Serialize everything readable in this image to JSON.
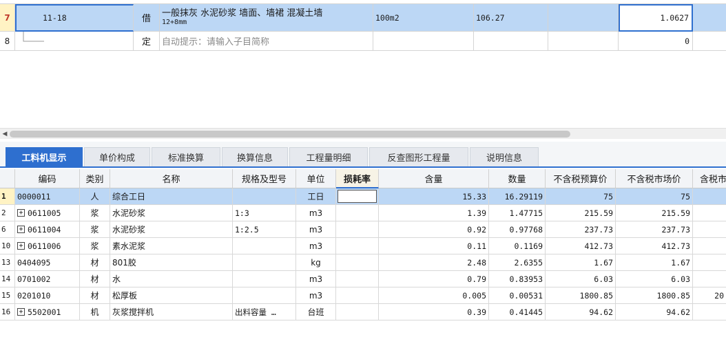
{
  "top_rows": [
    {
      "row_no": "7",
      "code": "11-18",
      "type": "借",
      "name_line1": "一般抹灰 水泥砂浆 墙面、墙裙 混凝土墙",
      "name_line2": "12+8mm",
      "unit": "100m2",
      "quantity": "106.27",
      "extra": "",
      "value": "1.0627"
    },
    {
      "row_no": "8",
      "code": "",
      "type": "定",
      "name_line1": "自动提示：请输入子目简称",
      "name_line2": "",
      "unit": "",
      "quantity": "",
      "extra": "",
      "value": "0"
    }
  ],
  "tabs": [
    {
      "label": "工料机显示",
      "active": true
    },
    {
      "label": "单价构成",
      "active": false
    },
    {
      "label": "标准换算",
      "active": false
    },
    {
      "label": "换算信息",
      "active": false
    },
    {
      "label": "工程量明细",
      "active": false
    },
    {
      "label": "反查图形工程量",
      "active": false
    },
    {
      "label": "说明信息",
      "active": false
    }
  ],
  "columns": [
    "编码",
    "类别",
    "名称",
    "规格及型号",
    "单位",
    "损耗率",
    "含量",
    "数量",
    "不含税预算价",
    "不含税市场价",
    "含税市"
  ],
  "rows": [
    {
      "row_no": "1",
      "expand": false,
      "code": "0000011",
      "category": "人",
      "name": "综合工日",
      "spec": "",
      "unit": "工日",
      "loss": "",
      "content": "15.33",
      "qty": "16.29119",
      "budget_price": "75",
      "market_price": "75",
      "tax_price": ""
    },
    {
      "row_no": "2",
      "expand": true,
      "code": "0611005",
      "category": "浆",
      "name": "水泥砂浆",
      "spec": "1:3",
      "unit": "m3",
      "loss": "",
      "content": "1.39",
      "qty": "1.47715",
      "budget_price": "215.59",
      "market_price": "215.59",
      "tax_price": ""
    },
    {
      "row_no": "6",
      "expand": true,
      "code": "0611004",
      "category": "浆",
      "name": "水泥砂浆",
      "spec": "1:2.5",
      "unit": "m3",
      "loss": "",
      "content": "0.92",
      "qty": "0.97768",
      "budget_price": "237.73",
      "market_price": "237.73",
      "tax_price": ""
    },
    {
      "row_no": "10",
      "expand": true,
      "code": "0611006",
      "category": "浆",
      "name": "素水泥浆",
      "spec": "",
      "unit": "m3",
      "loss": "",
      "content": "0.11",
      "qty": "0.1169",
      "budget_price": "412.73",
      "market_price": "412.73",
      "tax_price": ""
    },
    {
      "row_no": "13",
      "expand": false,
      "code": "0404095",
      "category": "材",
      "name": "801胶",
      "spec": "",
      "unit": "kg",
      "loss": "",
      "content": "2.48",
      "qty": "2.6355",
      "budget_price": "1.67",
      "market_price": "1.67",
      "tax_price": ""
    },
    {
      "row_no": "14",
      "expand": false,
      "code": "0701002",
      "category": "材",
      "name": "水",
      "spec": "",
      "unit": "m3",
      "loss": "",
      "content": "0.79",
      "qty": "0.83953",
      "budget_price": "6.03",
      "market_price": "6.03",
      "tax_price": ""
    },
    {
      "row_no": "15",
      "expand": false,
      "code": "0201010",
      "category": "材",
      "name": "松厚板",
      "spec": "",
      "unit": "m3",
      "loss": "",
      "content": "0.005",
      "qty": "0.00531",
      "budget_price": "1800.85",
      "market_price": "1800.85",
      "tax_price": "20"
    },
    {
      "row_no": "16",
      "expand": true,
      "code": "5502001",
      "category": "机",
      "name": "灰浆搅拌机",
      "spec": "出料容量 …",
      "unit": "台班",
      "loss": "",
      "content": "0.39",
      "qty": "0.41445",
      "budget_price": "94.62",
      "market_price": "94.62",
      "tax_price": ""
    }
  ]
}
